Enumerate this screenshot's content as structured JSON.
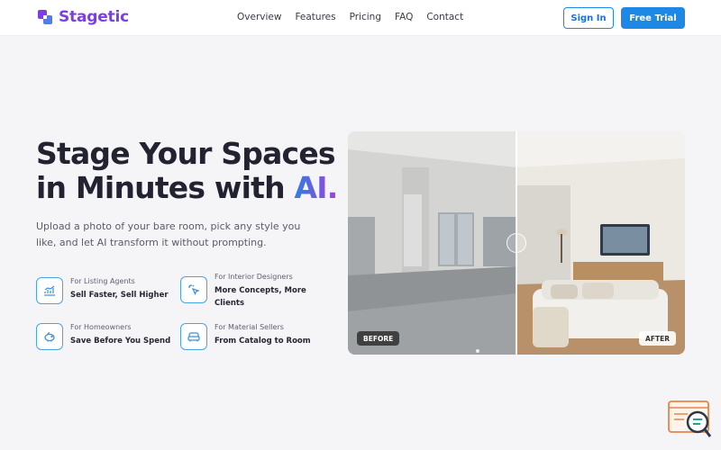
{
  "brand": {
    "name": "Stagetic",
    "color": "#7b3fe4"
  },
  "nav": {
    "items": [
      "Overview",
      "Features",
      "Pricing",
      "FAQ",
      "Contact"
    ]
  },
  "auth": {
    "signin": "Sign In",
    "trial": "Free Trial"
  },
  "hero": {
    "title_line1": "Stage Your Spaces",
    "title_line2": "in Minutes with ",
    "title_ai": "AI.",
    "subtitle": "Upload a photo of your bare room, pick any style you like, and let AI transform it without prompting."
  },
  "features": [
    {
      "category": "For Listing Agents",
      "title": "Sell Faster, Sell Higher",
      "icon": "chart-icon"
    },
    {
      "category": "For Interior Designers",
      "title": "More Concepts, More Clients",
      "icon": "cursor-sparkle-icon"
    },
    {
      "category": "For Homeowners",
      "title": "Save Before You Spend",
      "icon": "piggy-bank-icon"
    },
    {
      "category": "For Material Sellers",
      "title": "From Catalog to Room",
      "icon": "sofa-icon"
    }
  ],
  "compare": {
    "before_label": "BEFORE",
    "after_label": "AFTER"
  },
  "colors": {
    "accent": "#1e88e5",
    "gradient_start": "#2f7fe0",
    "gradient_end": "#a23fe0"
  }
}
